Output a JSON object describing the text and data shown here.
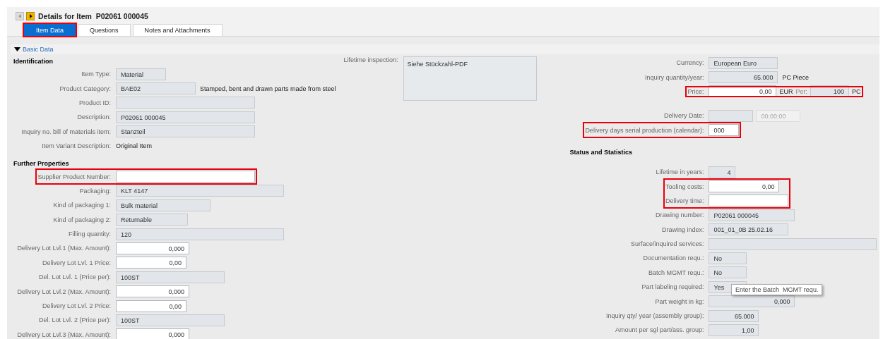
{
  "nav": [
    {
      "kind": "prev",
      "disabled": true
    },
    {
      "kind": "next",
      "disabled": false
    }
  ],
  "title": "Details for Item  P02061 000045",
  "tabs": [
    {
      "label": "Item Data",
      "selected": true,
      "highlighted": true
    },
    {
      "label": "Questions",
      "selected": false,
      "highlighted": false
    },
    {
      "label": "Notes and Attachments",
      "selected": false,
      "highlighted": false
    }
  ],
  "section": {
    "label": "Basic Data",
    "expanded": true
  },
  "left": [
    {
      "kind": "heading",
      "label": "Identification",
      "highlighted": false
    },
    {
      "kind": "field",
      "label": "Item Type:",
      "value": "Material",
      "editable": false,
      "highlighted": false
    },
    {
      "kind": "field",
      "label": "Product Category:",
      "value": "BAE02",
      "note": "Stamped, bent and drawn parts made from steel",
      "editable": false,
      "highlighted": false
    },
    {
      "kind": "field",
      "label": "Product ID:",
      "editable": false,
      "highlighted": false
    },
    {
      "kind": "field",
      "label": "Description:",
      "value": "P02061 000045",
      "editable": false,
      "highlighted": false
    },
    {
      "kind": "field",
      "label": "Inquiry no. bill of materials item:",
      "value": "Stanzteil",
      "editable": false,
      "highlighted": false
    },
    {
      "kind": "text",
      "label": "Item Variant Description:",
      "value": "Original Item",
      "highlighted": false
    },
    {
      "kind": "heading",
      "label": "Further Properties",
      "highlighted": false
    },
    {
      "kind": "field",
      "label": "Supplier Product Number:",
      "editable": true,
      "highlighted": true
    },
    {
      "kind": "field",
      "label": "Packaging:",
      "value": "KLT 4147",
      "editable": false,
      "highlighted": false
    },
    {
      "kind": "field",
      "label": "Kind of packaging 1:",
      "value": "Bulk material",
      "editable": false,
      "highlighted": false
    },
    {
      "kind": "field",
      "label": "Kind of packaging 2:",
      "value": "Returnable",
      "editable": false,
      "highlighted": false
    },
    {
      "kind": "field",
      "label": "Filling quantity:",
      "value": "120",
      "editable": false,
      "highlighted": false
    },
    {
      "kind": "number",
      "label": "Delivery Lot Lvl.1 (Max. Amount):",
      "value": "0,000",
      "editable": true,
      "highlighted": false
    },
    {
      "kind": "number",
      "label": "Delivery Lot Lvl. 1 Price:",
      "value": "0,00",
      "editable": true,
      "highlighted": false
    },
    {
      "kind": "field",
      "label": "Del. Lot Lvl. 1 (Price per):",
      "value": "100ST",
      "editable": false,
      "highlighted": false
    },
    {
      "kind": "number",
      "label": "Delivery Lot Lvl.2 (Max. Amount):",
      "value": "0,000",
      "editable": true,
      "highlighted": false
    },
    {
      "kind": "number",
      "label": "Delivery Lot Lvl. 2 Price:",
      "value": "0,00",
      "editable": true,
      "highlighted": false
    },
    {
      "kind": "field",
      "label": "Del. Lot Lvl. 2 (Price per):",
      "value": "100ST",
      "editable": false,
      "highlighted": false
    },
    {
      "kind": "number",
      "label": "Delivery Lot Lvl.3 (Max. Amount):",
      "value": "0,000",
      "editable": true,
      "highlighted": false
    }
  ],
  "inspection": {
    "label": "Lifetime inspection:",
    "value": "Siehe Stückzahl-PDF",
    "editable": false
  },
  "right": [
    {
      "kind": "field",
      "label": "Currency:",
      "value": "European Euro",
      "editable": false,
      "highlighted": false
    },
    {
      "kind": "number",
      "label": "Inquiry quantity/year:",
      "value": "65.000",
      "note": "PC Piece",
      "editable": false,
      "highlighted": false
    },
    {
      "kind": "price",
      "label": "Price:",
      "value": "0,00",
      "currency": "EUR",
      "per_label": "Per:",
      "per_value": "100",
      "unit": "PC",
      "editable": true,
      "highlighted": true
    },
    {
      "kind": "date",
      "label": "Delivery Date:",
      "time": "00:00:00",
      "editable": false,
      "highlighted": false
    },
    {
      "kind": "field",
      "label": "Delivery days serial production (calendar):",
      "value": "000",
      "editable": true,
      "highlighted": true
    },
    {
      "kind": "heading",
      "label": "Status and Statistics",
      "highlighted": false
    },
    {
      "kind": "number",
      "label": "Lifetime in years:",
      "value": "4",
      "editable": false,
      "highlighted": false
    },
    {
      "kind": "group",
      "highlighted": true,
      "rows": [
        {
          "kind": "number",
          "label": "Tooling costs:",
          "value": "0,00",
          "editable": true,
          "highlighted": false
        },
        {
          "kind": "field",
          "label": "Delivery time:",
          "editable": true,
          "highlighted": false
        }
      ]
    },
    {
      "kind": "field",
      "label": "Drawing number:",
      "value": "P02061 000045",
      "editable": false,
      "highlighted": false
    },
    {
      "kind": "field",
      "label": "Drawing index:",
      "value": "001_01_0B 25.02.16",
      "editable": false,
      "highlighted": false
    },
    {
      "kind": "field",
      "label": "Surface/inquired services:",
      "editable": false,
      "highlighted": false
    },
    {
      "kind": "field",
      "label": "Documentation requ.:",
      "value": "No",
      "editable": false,
      "highlighted": false
    },
    {
      "kind": "field",
      "label": "Batch  MGMT requ.:",
      "value": "No",
      "editable": false,
      "highlighted": false
    },
    {
      "kind": "field",
      "label": "Part labeling required:",
      "value": "Yes",
      "editable": false,
      "highlighted": false
    },
    {
      "kind": "number",
      "label": "Part weight in kg:",
      "value": "0,000",
      "editable": false,
      "highlighted": false
    },
    {
      "kind": "number",
      "label": "Inquiry qty/ year (assembly group):",
      "value": "65.000",
      "editable": false,
      "highlighted": false
    },
    {
      "kind": "number",
      "label": "Amount per sgl part/ass. group:",
      "value": "1,00",
      "editable": false,
      "highlighted": false
    }
  ],
  "tooltip": {
    "text": "Enter the Batch  MGMT requ."
  }
}
